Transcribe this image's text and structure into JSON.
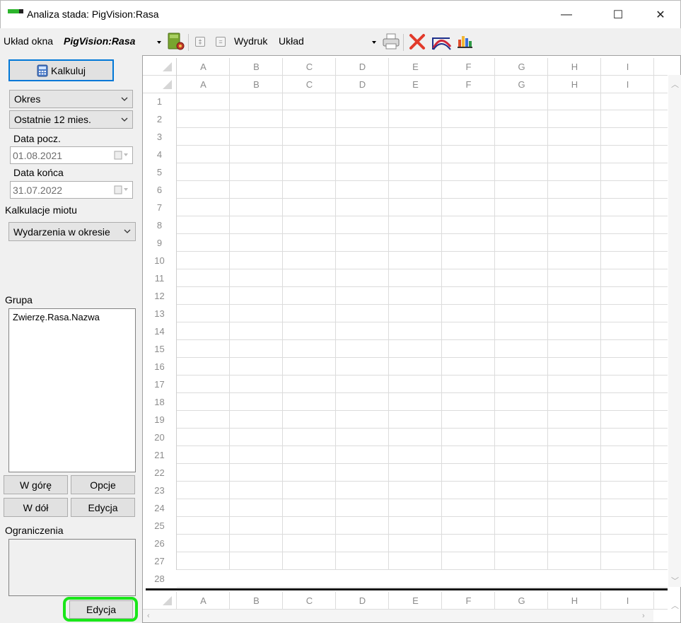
{
  "window": {
    "title": "Analiza stada: PigVision:Rasa",
    "minimize_glyph": "—",
    "maximize_glyph": "☐",
    "close_glyph": "✕"
  },
  "toolbar": {
    "layout_label": "Układ okna",
    "layout_value": "PigVision:Rasa",
    "print_label": "Wydruk",
    "print_value": "Układ",
    "small_btn_1": "‡",
    "small_btn_2": "=",
    "icons": [
      "layout-settings-icon",
      "printer-icon",
      "delete-x-icon",
      "line-chart-icon",
      "bar-chart-icon"
    ]
  },
  "left": {
    "calculate_label": "Kalkuluj",
    "period_mode": "Okres",
    "period_range": "Ostatnie 12 mies.",
    "start_date_label": "Data pocz.",
    "start_date": "01.08.2021",
    "end_date_label": "Data końca",
    "end_date": "31.07.2022",
    "litter_calc_label": "Kalkulacje miotu",
    "litter_calc_value": "Wydarzenia w okresie",
    "group_label": "Grupa",
    "group_items": [
      "Zwierzę.Rasa.Nazwa"
    ],
    "up_label": "W górę",
    "options_label": "Opcje",
    "down_label": "W dół",
    "edit_label": "Edycja",
    "constraints_label": "Ograniczenia",
    "constraints_edit_label": "Edycja"
  },
  "grid": {
    "columns": [
      "A",
      "B",
      "C",
      "D",
      "E",
      "F",
      "G",
      "H",
      "I"
    ],
    "rows": [
      "1",
      "2",
      "3",
      "4",
      "5",
      "6",
      "7",
      "8",
      "9",
      "10",
      "11",
      "12",
      "13",
      "14",
      "15",
      "16",
      "17",
      "18",
      "19",
      "20",
      "21",
      "22",
      "23",
      "24",
      "25",
      "26",
      "27",
      "28"
    ]
  },
  "colors": {
    "highlight": "#19e619",
    "accent_border": "#0078d7"
  }
}
